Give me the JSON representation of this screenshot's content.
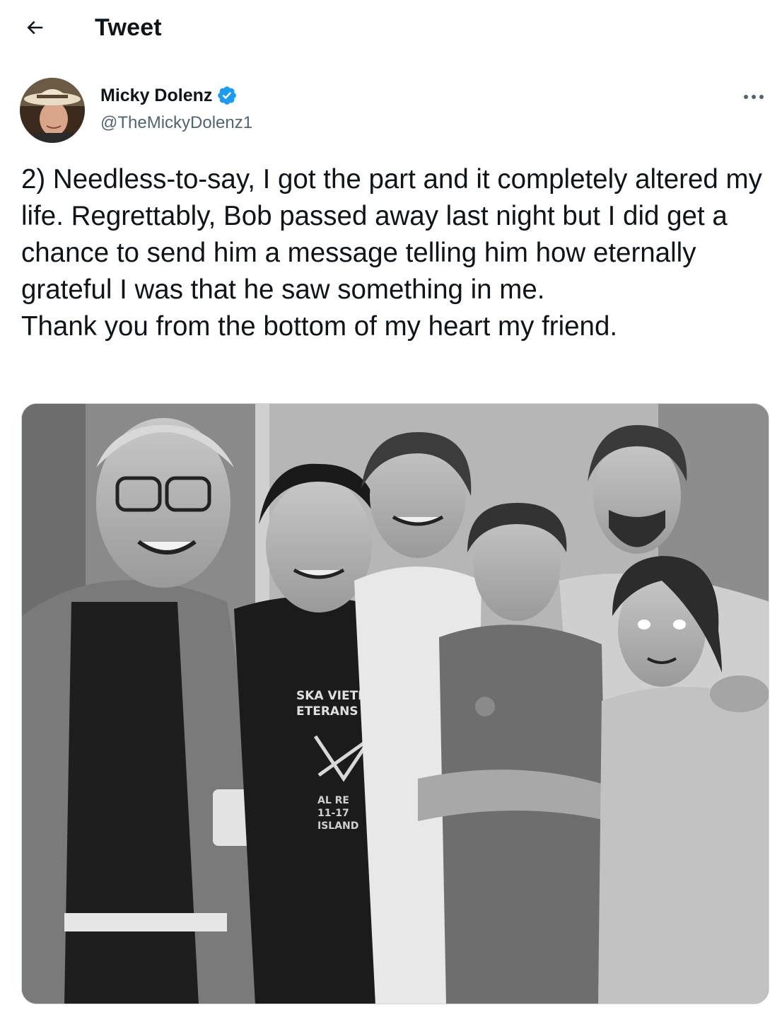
{
  "header": {
    "back_icon": "arrow-left-icon",
    "title": "Tweet"
  },
  "author": {
    "display_name": "Micky Dolenz",
    "handle": "@TheMickyDolenz1",
    "verified": true,
    "verified_icon": "verified-badge-icon",
    "more_icon": "more-horizontal-icon",
    "avatar_icon": "avatar"
  },
  "tweet": {
    "line1": "2) Needless-to-say, I got the part and it completely altered my life. Regrettably, Bob passed away last night but I did get a chance to send him a message telling him how eternally grateful I was that he saw something in me.",
    "line2": "Thank you from the bottom of my heart my friend."
  },
  "media": {
    "type": "photo",
    "style": "black-and-white",
    "shirt_text_1": "SKA VIETNAM",
    "shirt_text_2": "ETERANS",
    "shirt_text_3": "AL RE",
    "shirt_text_4": "11-17",
    "shirt_text_5": "ISLAND"
  },
  "colors": {
    "text_primary": "#0f1419",
    "text_secondary": "#536471",
    "verified_blue": "#1d9bf0",
    "border": "#cfd9de"
  }
}
